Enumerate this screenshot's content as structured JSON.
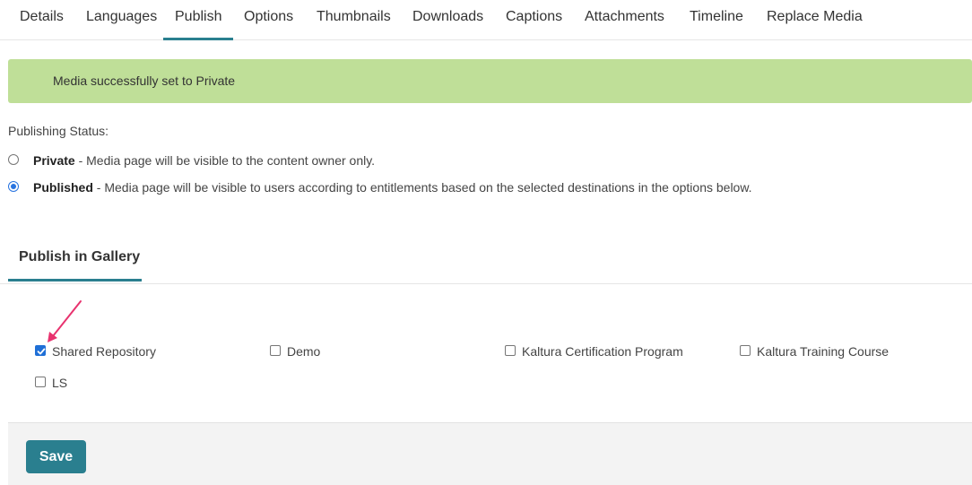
{
  "tabs": [
    {
      "label": "Details"
    },
    {
      "label": "Languages"
    },
    {
      "label": "Publish"
    },
    {
      "label": "Options"
    },
    {
      "label": "Thumbnails"
    },
    {
      "label": "Downloads"
    },
    {
      "label": "Captions"
    },
    {
      "label": "Attachments"
    },
    {
      "label": "Timeline"
    },
    {
      "label": "Replace Media"
    }
  ],
  "active_tab": "Publish",
  "alert": {
    "message": "Media successfully set to Private",
    "color": "#bfdf98"
  },
  "publishing": {
    "label": "Publishing Status:",
    "options": [
      {
        "title": "Private",
        "description": " - Media page will be visible to the content owner only.",
        "selected": false
      },
      {
        "title": "Published",
        "description": " - Media page will be visible to users according to entitlements based on the selected destinations in the options below.",
        "selected": true
      }
    ]
  },
  "gallery": {
    "tab_label": "Publish in Gallery",
    "items": [
      {
        "label": "Shared Repository",
        "checked": true
      },
      {
        "label": "Demo",
        "checked": false
      },
      {
        "label": "Kaltura Certification Program",
        "checked": false
      },
      {
        "label": "Kaltura Training Course",
        "checked": false
      },
      {
        "label": "LS",
        "checked": false
      }
    ]
  },
  "footer": {
    "save_label": "Save"
  },
  "colors": {
    "accent": "#2a7f8f",
    "annotation_arrow": "#e8336f",
    "checkbox_checked": "#1f6fd6"
  }
}
